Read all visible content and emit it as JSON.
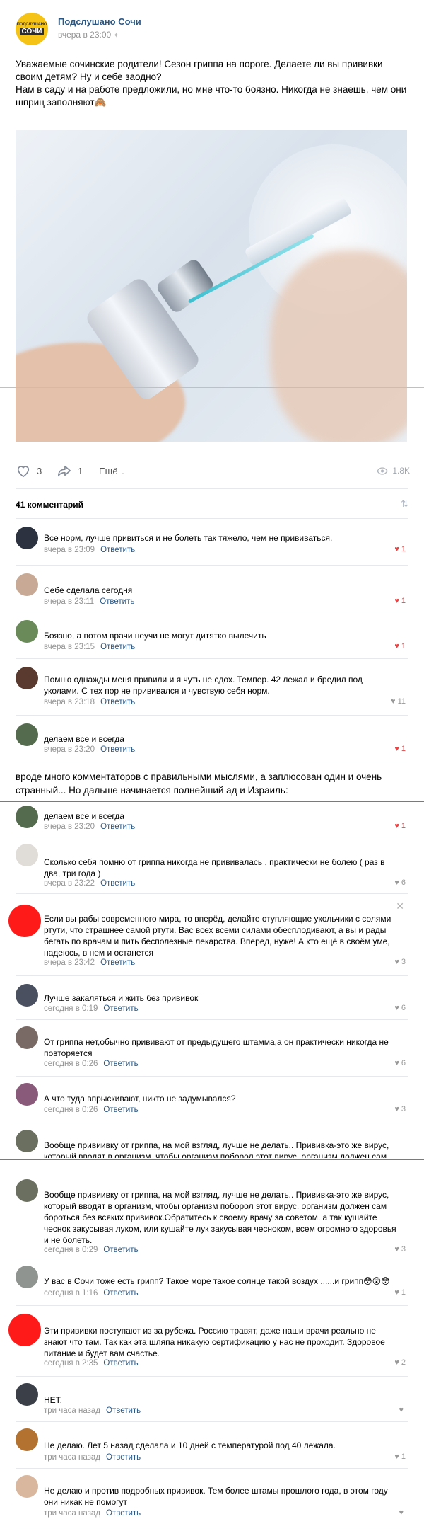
{
  "post": {
    "group_name": "Подслушано Сочи",
    "time": "вчера в 23:00",
    "logo_top": "ПОДСЛУШАНО",
    "logo_bottom": "СОЧИ",
    "text_lines": [
      "Уважаемые сочинские родители! Сезон гриппа на пороге. Делаете ли вы прививки своим детям? Ну и себе заодно?",
      "Нам в саду и на работе предложили, но мне что-то боязно. Никогда не знаешь, чем они шприц заполняют🙈"
    ],
    "likes": "3",
    "shares": "1",
    "more_label": "Ещё",
    "views": "1.8K",
    "comments_title": "41 комментарий"
  },
  "comments_block1": [
    {
      "text": "Все норм, лучше привиться и не болеть так тяжело, чем не прививаться.",
      "time": "вчера в 23:09",
      "reply": "Ответить",
      "likes": "1",
      "liked": true
    },
    {
      "text": "Себе сделала сегодня",
      "time": "вчера в 23:11",
      "reply": "Ответить",
      "likes": "1",
      "liked": true
    },
    {
      "text": "Боязно, а потом врачи неучи не могут дитятко вылечить",
      "time": "вчера в 23:15",
      "reply": "Ответить",
      "likes": "1",
      "liked": true
    },
    {
      "text": "Помню однажды меня привили и я чуть не сдох. Темпер. 42 лежал и бредил под уколами. С тех пор не прививался и чувствую себя норм.",
      "time": "вчера в 23:18",
      "reply": "Ответить",
      "likes": "11",
      "liked": false
    },
    {
      "text": "делаем все и всегда",
      "time": "вчера в 23:20",
      "reply": "Ответить",
      "likes": "1",
      "liked": true
    }
  ],
  "caption": "вроде много комментаторов с правильными мыслями, а заплюсован один и очень странный... Но дальше начинается полнейший ад и Израиль:",
  "comments_block2": [
    {
      "text": "делаем все и всегда",
      "time": "вчера в 23:20",
      "reply": "Ответить",
      "likes": "1",
      "liked": true
    },
    {
      "text": "Сколько себя помню от гриппа никогда не прививалась , практически не болею ( раз в два, три года )",
      "time": "вчера в 23:22",
      "reply": "Ответить",
      "likes": "6",
      "liked": false
    },
    {
      "text": "Если вы рабы современного мира, то вперёд, делайте отупляющие укольчики с солями ртути, что страшнее самой ртути. Вас всех всеми силами обесплодивают, а вы и рады бегать по врачам и пить бесполезные лекарства. Вперед, нуже! А кто ещё в своём уме, надеюсь, в нем и останется",
      "time": "вчера в 23:42",
      "reply": "Ответить",
      "likes": "3",
      "liked": false
    },
    {
      "text": "Лучше закаляться и жить без прививок",
      "time": "сегодня в 0:19",
      "reply": "Ответить",
      "likes": "6",
      "liked": false
    },
    {
      "text": "От гриппа нет,обычно прививают от предыдущего штамма,а он практически никогда не повторяется",
      "time": "сегодня в 0:26",
      "reply": "Ответить",
      "likes": "6",
      "liked": false
    },
    {
      "text": "А что туда впрыскивают, никто не задумывался?",
      "time": "сегодня в 0:26",
      "reply": "Ответить",
      "likes": "3",
      "liked": false
    },
    {
      "text": "Вообще привиивку от гриппа, на мой взгляд, лучше не делать.. Прививка-это же вирус, который вводят в организм, чтобы организм поборол этот вирус. организм должен сам",
      "time": "",
      "reply": "",
      "likes": "",
      "liked": false
    }
  ],
  "comments_block3": [
    {
      "text": "Вообще привиивку от гриппа, на мой взгляд, лучше не делать.. Прививка-это же вирус, который вводят в организм, чтобы организм поборол этот вирус. организм должен сам бороться без всяких прививок.Обратитесь к своему врачу за советом. а так кушайте чеснок закусывая луком, или кушайте лук закусывая чесноком, всем огромного здоровья и не болеть.",
      "time": "сегодня в 0:29",
      "reply": "Ответить",
      "likes": "3",
      "liked": false
    },
    {
      "text": "У вас в Сочи тоже есть грипп? Такое море такое солнце такой воздух ......и грипп😳😲😳",
      "time": "сегодня в 1:16",
      "reply": "Ответить",
      "likes": "1",
      "liked": false
    },
    {
      "text": "Эти прививки поступают из за рубежа. Россию травят, даже наши врачи реально не знают что там. Так как эта шляпа никакую сертификацию у нас не проходит. Здоровое питание и будет вам счастье.",
      "time": "сегодня в 2:35",
      "reply": "Ответить",
      "likes": "2",
      "liked": false
    },
    {
      "text": "НЕТ.",
      "time": "три часа назад",
      "reply": "Ответить",
      "likes": "",
      "liked": false
    },
    {
      "text": "Не делаю. Лет 5 назад сделала и 10 дней с температурой под 40 лежала.",
      "time": "три часа назад",
      "reply": "Ответить",
      "likes": "1",
      "liked": false
    },
    {
      "text": "Не делаю и против подробных прививок. Тем более штамы прошлого года, в этом году они никак не помогут",
      "time": "три часа назад",
      "reply": "Ответить",
      "likes": "",
      "liked": false
    }
  ]
}
